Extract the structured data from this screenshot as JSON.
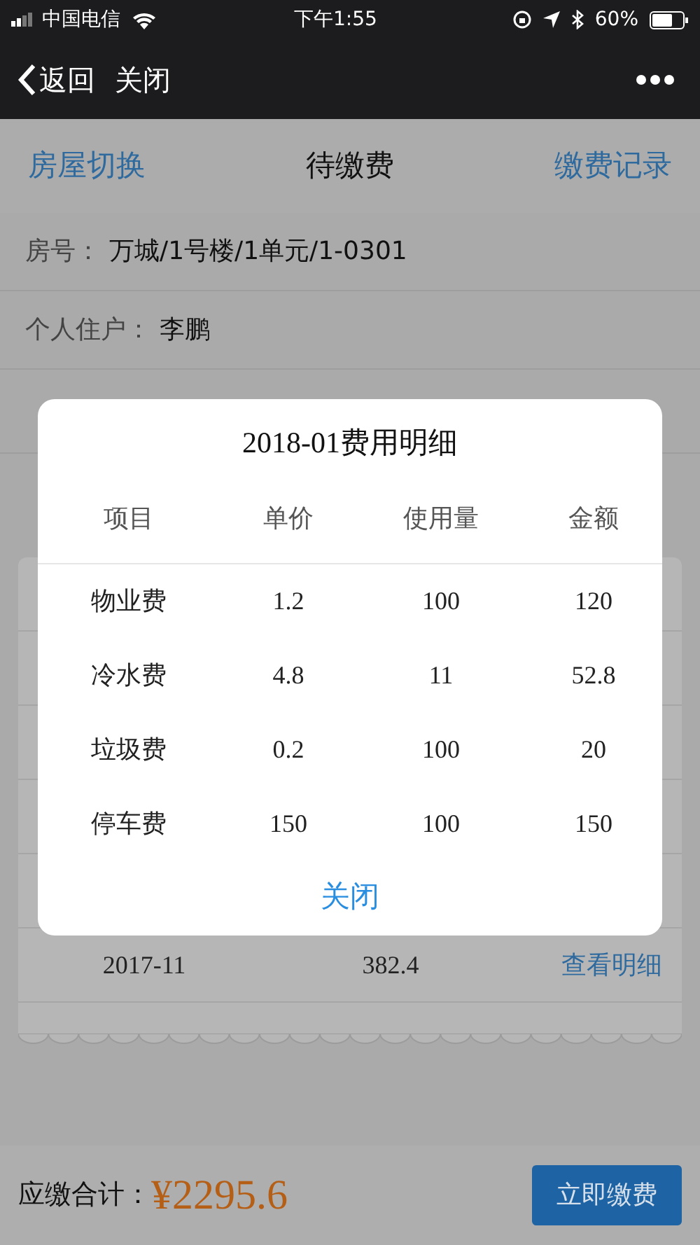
{
  "status_bar": {
    "carrier": "中国电信",
    "time": "下午1:55",
    "battery": "60%"
  },
  "nav": {
    "back": "返回",
    "close": "关闭"
  },
  "header": {
    "left": "房屋切换",
    "title": "待缴费",
    "right": "缴费记录"
  },
  "info_rows": [
    {
      "label": "房号：",
      "value": "万城/1号楼/1单元/1-0301"
    },
    {
      "label": "个人住户：",
      "value": "李鹏"
    }
  ],
  "bills": [
    {
      "month": "2017-11",
      "amount": "382.4",
      "link": "查看明细"
    }
  ],
  "modal": {
    "title": "2018-01费用明细",
    "columns": [
      "项目",
      "单价",
      "使用量",
      "金额"
    ],
    "rows": [
      [
        "物业费",
        "1.2",
        "100",
        "120"
      ],
      [
        "冷水费",
        "4.8",
        "11",
        "52.8"
      ],
      [
        "垃圾费",
        "0.2",
        "100",
        "20"
      ],
      [
        "停车费",
        "150",
        "100",
        "150"
      ]
    ],
    "close": "关闭"
  },
  "footer": {
    "label": "应缴合计：",
    "total": "¥2295.6",
    "pay": "立即缴费"
  }
}
